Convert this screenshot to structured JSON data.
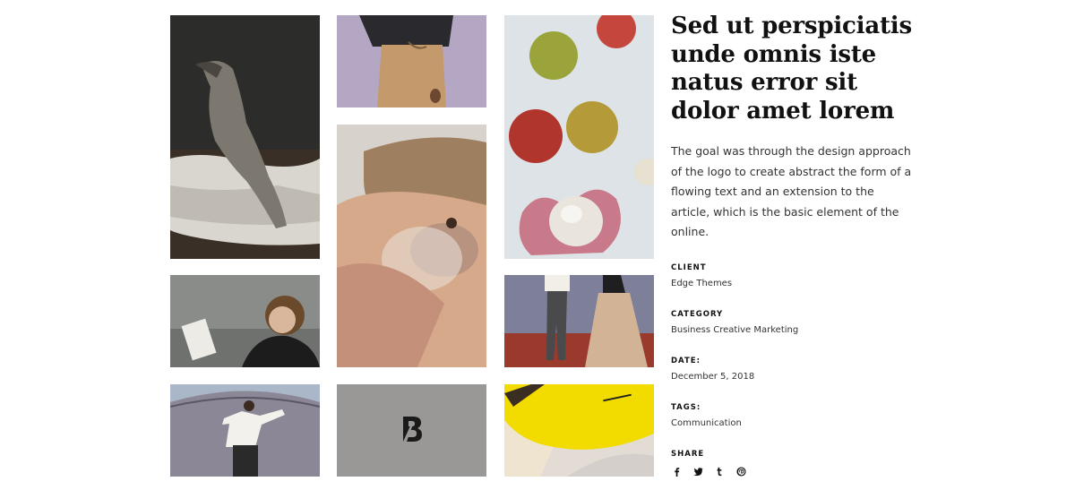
{
  "project": {
    "title": "Sed ut perspiciatis unde omnis iste natus error sit dolor amet lorem",
    "description": "The goal was through the design approach of the logo to create abstract the form of a flowing text and an extension to the article, which is the basic element of the online."
  },
  "details": {
    "client_label": "CLIENT",
    "client_value": "Edge Themes",
    "category_label": "CATEGORY",
    "category_value": "Business Creative Marketing",
    "date_label": "DATE:",
    "date_value": "December 5, 2018",
    "tags_label": "TAGS:",
    "tags_value": "Communication",
    "share_label": "SHARE"
  },
  "share_icons": [
    "facebook-icon",
    "twitter-icon",
    "tumblr-icon",
    "pinterest-icon"
  ],
  "colors": {
    "accent_yellow": "#f2dc00",
    "text_dark": "#111111",
    "logo_tile_bg": "#9a9896"
  },
  "logo_tile": {
    "glyph": "B"
  }
}
